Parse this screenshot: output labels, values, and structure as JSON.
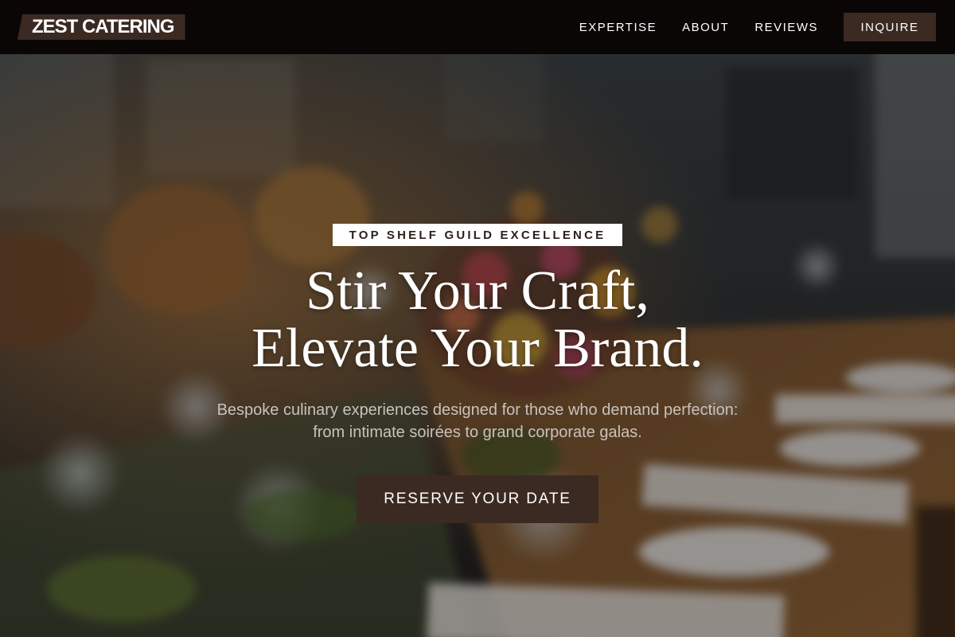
{
  "brand": {
    "name": "ZEST CATERING"
  },
  "nav": {
    "links": [
      {
        "label": "EXPERTISE"
      },
      {
        "label": "ABOUT"
      },
      {
        "label": "REVIEWS"
      }
    ],
    "cta_label": "INQUIRE"
  },
  "hero": {
    "badge": "TOP SHELF GUILD EXCELLENCE",
    "headline": [
      "Stir Your Craft,",
      "Elevate Your Brand."
    ],
    "subtext": [
      "Bespoke culinary experiences designed for those who demand perfection:",
      "from intimate soirées to grand corporate galas."
    ],
    "cta_label": "RESERVE YOUR DATE",
    "background_image": "blurred-banquet-table-photo"
  },
  "colors": {
    "nav_background": "#0a0605",
    "accent_brown": "#3b2a22",
    "badge_background": "#ffffff",
    "headline": "#ffffff",
    "subtext": "#c8c2bd"
  }
}
